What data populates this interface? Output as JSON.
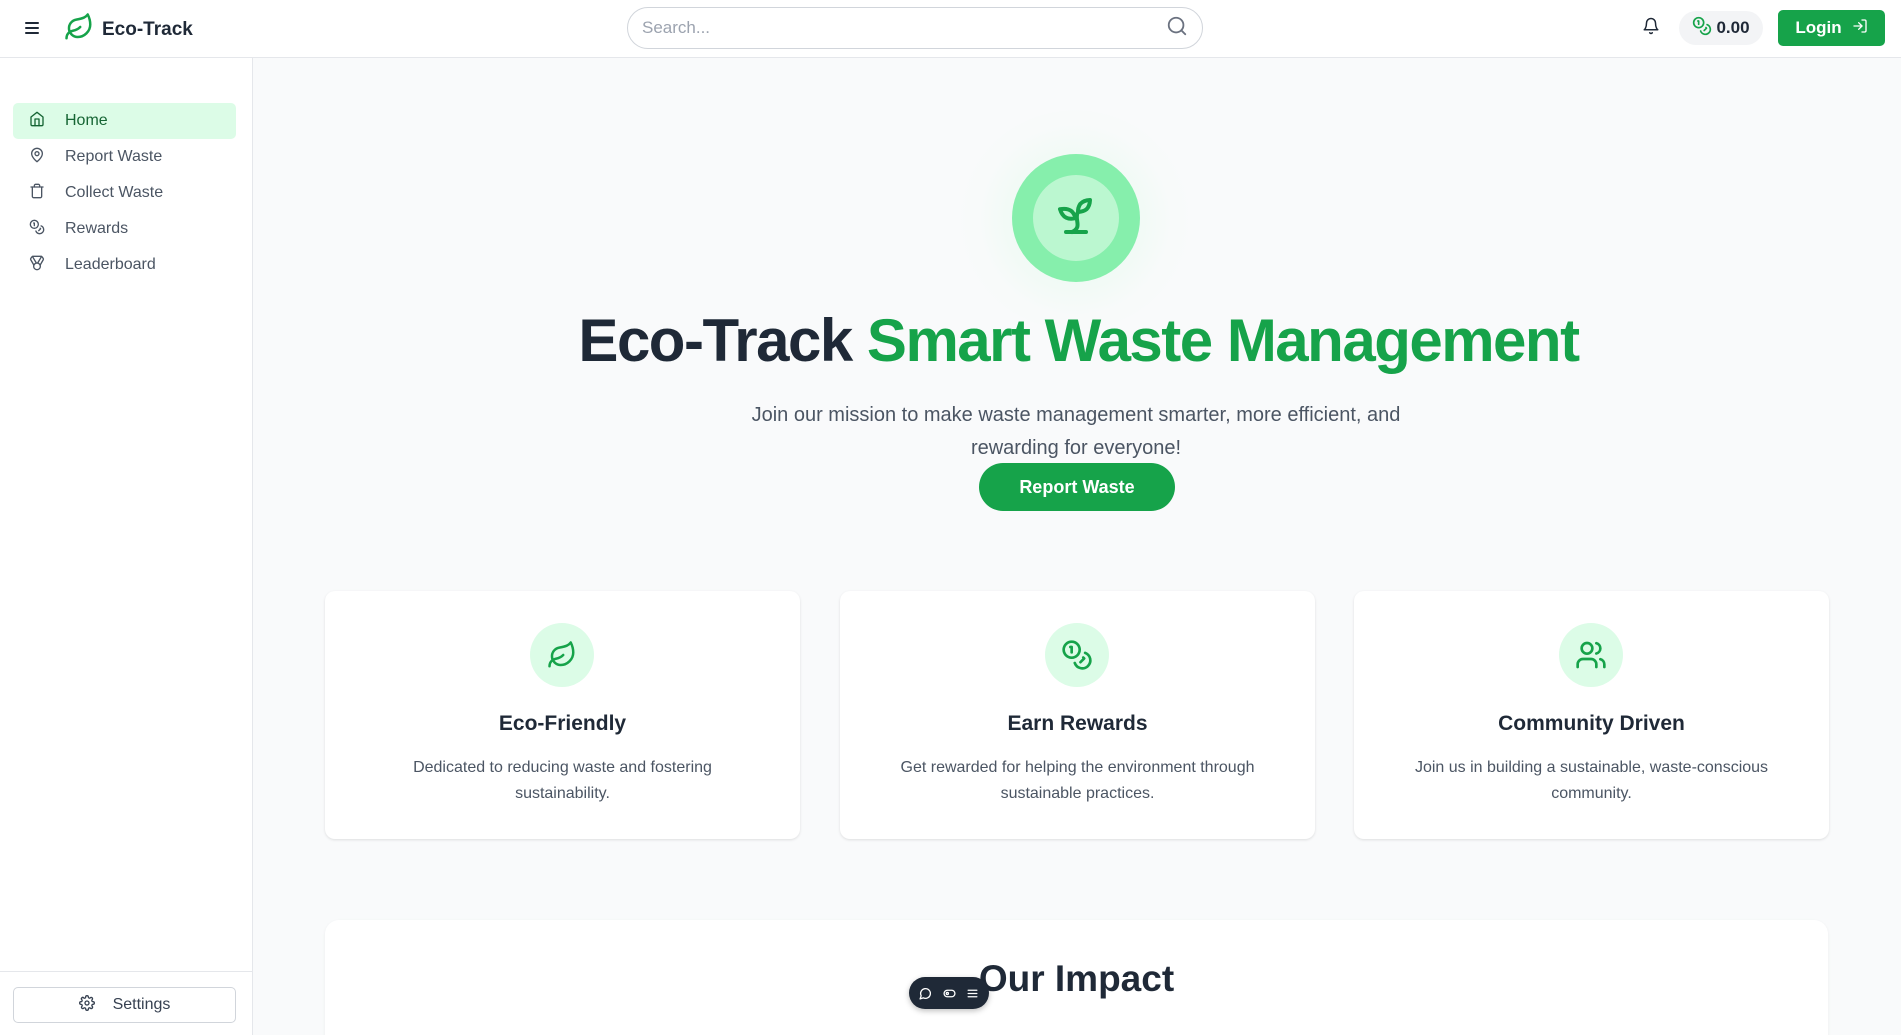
{
  "header": {
    "brand": "Eco-Track",
    "search_placeholder": "Search...",
    "balance": "0.00",
    "login_label": "Login"
  },
  "sidebar": {
    "items": [
      {
        "label": "Home",
        "icon": "home-icon",
        "active": true
      },
      {
        "label": "Report Waste",
        "icon": "map-pin-icon",
        "active": false
      },
      {
        "label": "Collect Waste",
        "icon": "trash-icon",
        "active": false
      },
      {
        "label": "Rewards",
        "icon": "coins-icon",
        "active": false
      },
      {
        "label": "Leaderboard",
        "icon": "medal-icon",
        "active": false
      }
    ],
    "settings_label": "Settings"
  },
  "hero": {
    "title_dark": "Eco-Track",
    "title_green": "Smart Waste Management",
    "subtitle": "Join our mission to make waste management smarter, more efficient, and rewarding for everyone!",
    "cta_label": "Report Waste"
  },
  "features": [
    {
      "title": "Eco-Friendly",
      "description": "Dedicated to reducing waste and fostering sustainability.",
      "icon": "leaf-icon"
    },
    {
      "title": "Earn Rewards",
      "description": "Get rewarded for helping the environment through sustainable practices.",
      "icon": "coins-icon"
    },
    {
      "title": "Community Driven",
      "description": "Join us in building a sustainable, waste-conscious community.",
      "icon": "users-icon"
    }
  ],
  "impact": {
    "title": "Our Impact"
  },
  "colors": {
    "brand_green": "#16a34a",
    "active_nav_bg": "#dcfce7",
    "text_dark": "#1f2937"
  }
}
